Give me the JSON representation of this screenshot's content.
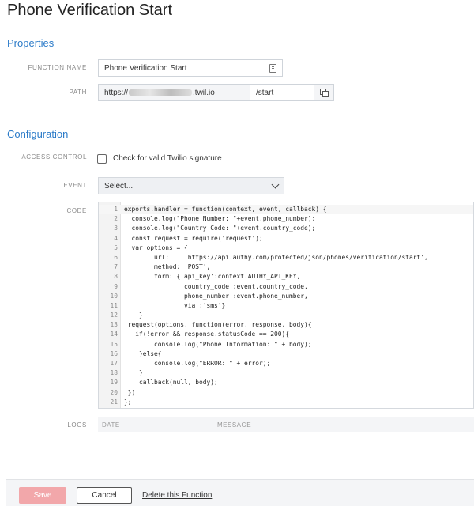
{
  "page": {
    "title": "Phone Verification Start"
  },
  "properties": {
    "heading": "Properties",
    "function_name": {
      "label": "FUNCTION NAME",
      "value": "Phone Verification Start"
    },
    "path": {
      "label": "PATH",
      "prefix": "https://",
      "domain_suffix": ".twil.io",
      "subpath": "/start"
    }
  },
  "configuration": {
    "heading": "Configuration",
    "access_control": {
      "label": "ACCESS CONTROL",
      "checkbox_label": "Check for valid Twilio signature",
      "checked": false
    },
    "event": {
      "label": "EVENT",
      "selected": "Select..."
    },
    "code": {
      "label": "CODE",
      "lines": [
        "exports.handler = function(context, event, callback) {",
        "  console.log(\"Phone Number: \"+event.phone_number);",
        "  console.log(\"Country Code: \"+event.country_code);",
        "  const request = require('request');",
        "  var options = {",
        "        url:    'https://api.authy.com/protected/json/phones/verification/start',",
        "        method: 'POST',",
        "        form: {'api_key':context.AUTHY_API_KEY,",
        "               'country_code':event.country_code,",
        "               'phone_number':event.phone_number,",
        "               'via':'sms'}",
        "    }",
        " request(options, function(error, response, body){",
        "   if(!error && response.statusCode == 200){",
        "        console.log(\"Phone Information: \" + body);",
        "    }else{",
        "        console.log(\"ERROR: \" + error);",
        "    }",
        "    callback(null, body);",
        " })",
        "};"
      ]
    },
    "logs": {
      "label": "LOGS",
      "columns": [
        "DATE",
        "MESSAGE"
      ]
    }
  },
  "footer": {
    "save_label": "Save",
    "cancel_label": "Cancel",
    "delete_label": "Delete this Function"
  },
  "colors": {
    "accent": "#2a7ac8",
    "save_button": "#f2a7aa"
  }
}
